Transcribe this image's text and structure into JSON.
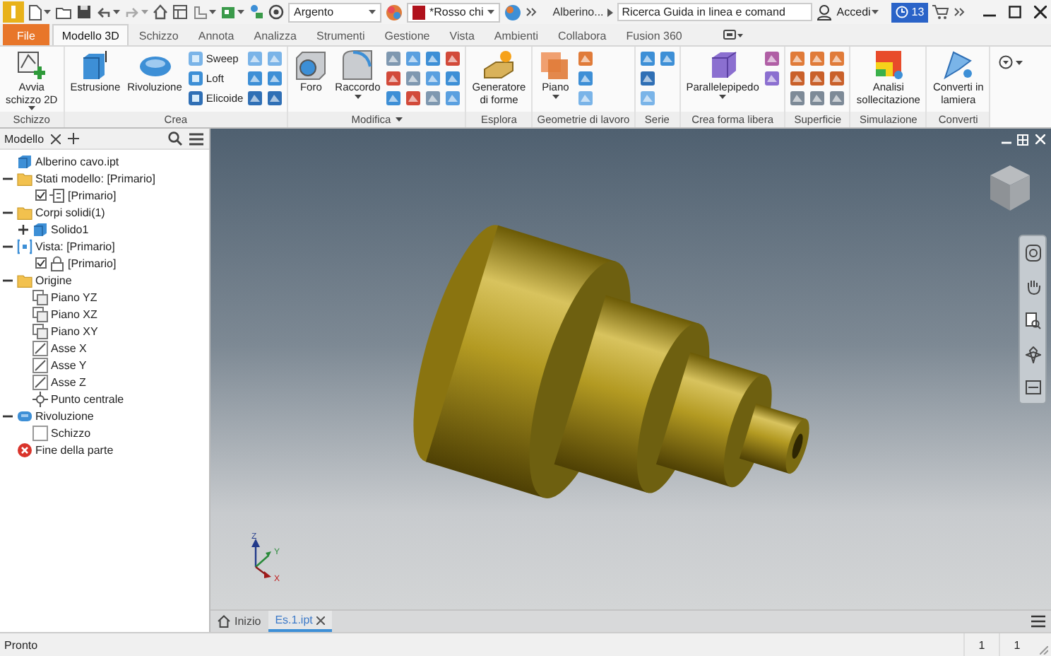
{
  "title_bar": {
    "material": "Argento",
    "appearance": "*Rosso chi",
    "document": "Alberino...",
    "search": {
      "placeholder": "Ricerca Guida in linea e comand"
    },
    "user": "Accedi",
    "badge": "13"
  },
  "tabs": [
    {
      "label": "File",
      "kind": "file",
      "selected": false
    },
    {
      "label": "Modello 3D",
      "kind": "tab",
      "selected": true
    },
    {
      "label": "Schizzo",
      "kind": "tab",
      "selected": false
    },
    {
      "label": "Annota",
      "kind": "tab",
      "selected": false
    },
    {
      "label": "Analizza",
      "kind": "tab",
      "selected": false
    },
    {
      "label": "Strumenti",
      "kind": "tab",
      "selected": false
    },
    {
      "label": "Gestione",
      "kind": "tab",
      "selected": false
    },
    {
      "label": "Vista",
      "kind": "tab",
      "selected": false
    },
    {
      "label": "Ambienti",
      "kind": "tab",
      "selected": false
    },
    {
      "label": "Collabora",
      "kind": "tab",
      "selected": false
    },
    {
      "label": "Fusion 360",
      "kind": "tab",
      "selected": false
    }
  ],
  "ribbon": {
    "panels": [
      {
        "label": "Schizzo",
        "tools": [
          {
            "kind": "large",
            "label": "Avvia\nschizzo 2D",
            "dropdown": true
          }
        ]
      },
      {
        "label": "Crea",
        "kind": "solid",
        "tools": [
          {
            "kind": "large",
            "label": "Estrusione",
            "dropdown": false
          },
          {
            "kind": "large",
            "label": "Rivoluzione",
            "dropdown": false
          },
          {
            "kind": "small",
            "label": "Sweep"
          },
          {
            "kind": "small",
            "label": "Loft"
          },
          {
            "kind": "small",
            "label": "Elicoide"
          },
          {
            "kind": "icon"
          },
          {
            "kind": "icon"
          },
          {
            "kind": "icon"
          },
          {
            "kind": "icon"
          },
          {
            "kind": "icon"
          },
          {
            "kind": "icon"
          }
        ]
      },
      {
        "label": "Modifica",
        "kind": "modify",
        "dropdown": true,
        "tools": [
          {
            "kind": "large",
            "label": "Foro",
            "dropdown": false
          },
          {
            "kind": "large",
            "label": "Raccordo",
            "dropdown": true
          },
          {
            "kind": "icon"
          },
          {
            "kind": "icon"
          },
          {
            "kind": "icon"
          },
          {
            "kind": "icon"
          },
          {
            "kind": "icon"
          },
          {
            "kind": "icon"
          },
          {
            "kind": "icon"
          },
          {
            "kind": "icon"
          },
          {
            "kind": "icon"
          },
          {
            "kind": "icon"
          },
          {
            "kind": "icon"
          },
          {
            "kind": "icon"
          }
        ]
      },
      {
        "label": "Esplora",
        "tools": [
          {
            "kind": "large",
            "label": "Generatore\ndi forme",
            "dropdown": false
          }
        ]
      },
      {
        "label": "Geometrie di lavoro",
        "kind": "work",
        "tools": [
          {
            "kind": "large",
            "label": "Piano",
            "dropdown": true
          },
          {
            "kind": "icon"
          },
          {
            "kind": "icon"
          },
          {
            "kind": "icon"
          }
        ]
      },
      {
        "label": "Serie",
        "kind": "solid",
        "tools": [
          {
            "kind": "icon"
          },
          {
            "kind": "icon"
          },
          {
            "kind": "icon"
          },
          {
            "kind": "icon"
          }
        ]
      },
      {
        "label": "Crea forma libera",
        "kind": "freeform",
        "tools": [
          {
            "kind": "large",
            "label": "Parallelepipedo",
            "dropdown": true
          },
          {
            "kind": "icon"
          },
          {
            "kind": "icon"
          }
        ]
      },
      {
        "label": "Superficie",
        "kind": "surface",
        "tools": [
          {
            "kind": "icon"
          },
          {
            "kind": "icon"
          },
          {
            "kind": "icon"
          },
          {
            "kind": "icon"
          },
          {
            "kind": "icon"
          },
          {
            "kind": "icon"
          },
          {
            "kind": "icon"
          },
          {
            "kind": "icon"
          },
          {
            "kind": "icon"
          }
        ]
      },
      {
        "label": "Simulazione",
        "tools": [
          {
            "kind": "large",
            "label": "Analisi\nsollecitazione",
            "dropdown": false
          }
        ]
      },
      {
        "label": "Converti",
        "tools": [
          {
            "kind": "large",
            "label": "Converti in\nlamiera",
            "dropdown": false
          }
        ]
      }
    ]
  },
  "browser": {
    "tab": "Modello",
    "tree": [
      {
        "label": "Alberino cavo.ipt",
        "kind": "part"
      },
      {
        "label": "Stati modello: [Primario]",
        "kind": "folder",
        "expanded": true,
        "children": [
          {
            "label": "[Primario]",
            "kind": "state",
            "checked": true
          }
        ]
      },
      {
        "label": "Corpi solidi(1)",
        "kind": "folder",
        "expanded": true,
        "children": [
          {
            "label": "Solido1",
            "kind": "body",
            "expanded": false
          }
        ]
      },
      {
        "label": "Vista: [Primario]",
        "kind": "view",
        "expanded": true,
        "children": [
          {
            "label": "[Primario]",
            "kind": "lock",
            "checked": true
          }
        ]
      },
      {
        "label": "Origine",
        "kind": "folder",
        "expanded": true,
        "children": [
          {
            "label": "Piano YZ",
            "kind": "plane"
          },
          {
            "label": "Piano XZ",
            "kind": "plane"
          },
          {
            "label": "Piano XY",
            "kind": "plane"
          },
          {
            "label": "Asse X",
            "kind": "axis"
          },
          {
            "label": "Asse Y",
            "kind": "axis"
          },
          {
            "label": "Asse Z",
            "kind": "axis"
          },
          {
            "label": "Punto centrale",
            "kind": "point"
          }
        ]
      },
      {
        "label": "Rivoluzione",
        "kind": "revolve",
        "expanded": true,
        "children": [
          {
            "label": "Schizzo",
            "kind": "sketch"
          }
        ]
      },
      {
        "label": "Fine della parte",
        "kind": "end"
      }
    ]
  },
  "viewport": {
    "triad": {
      "z": "Z",
      "y": "Y",
      "x": "X"
    }
  },
  "document_tabs": [
    {
      "label": "Inizio",
      "kind": "home",
      "selected": false
    },
    {
      "label": "Es.1.ipt",
      "kind": "document",
      "selected": true
    }
  ],
  "status_bar": {
    "message": "Pronto",
    "cells": [
      "1",
      "1"
    ]
  }
}
